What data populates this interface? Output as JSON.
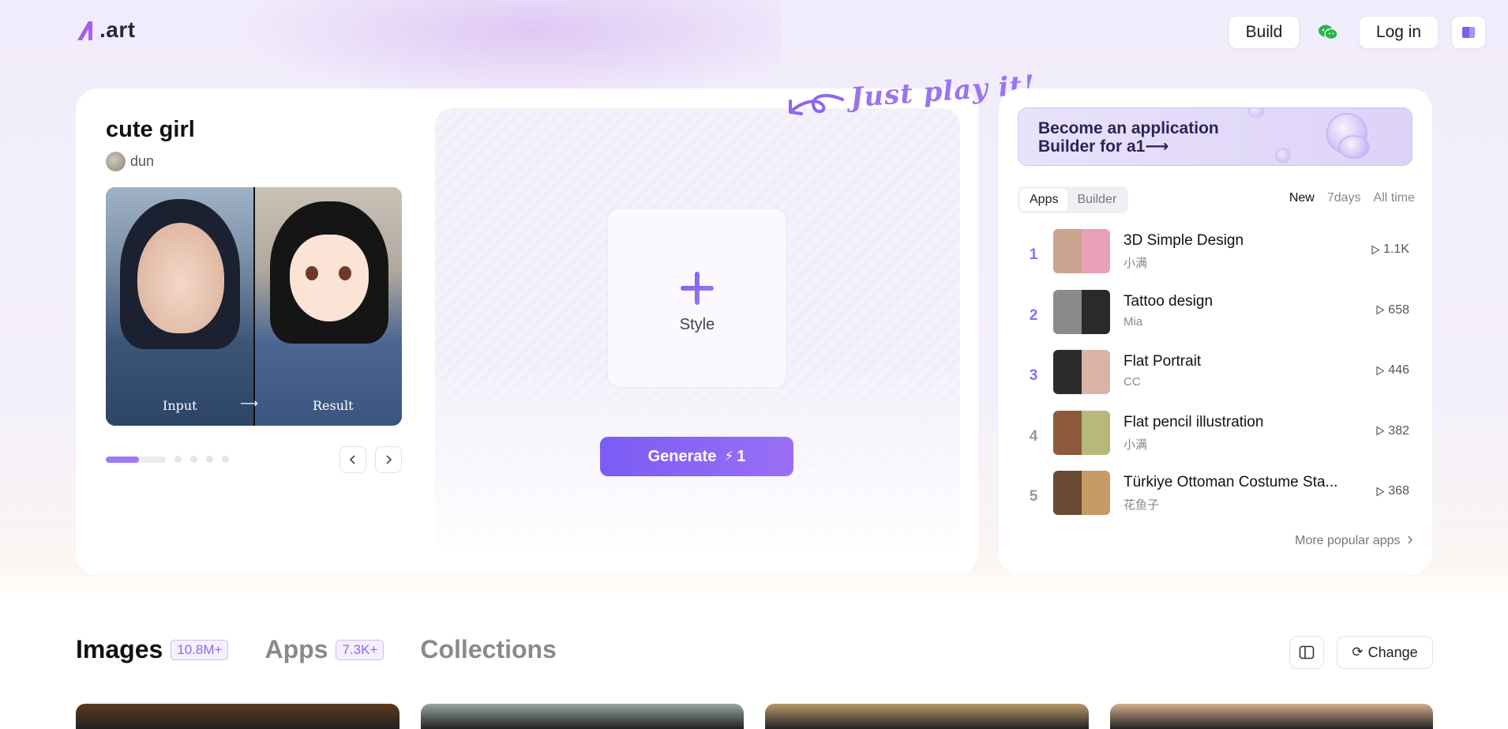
{
  "header": {
    "logo_text": ".art",
    "build_label": "Build",
    "login_label": "Log in"
  },
  "main": {
    "title": "cute girl",
    "author": "dun",
    "preview": {
      "input_label": "Input",
      "arrow": "⟶",
      "result_label": "Result"
    },
    "carousel": {
      "active_progress": 0.55,
      "total_slides": 5
    },
    "style_label": "Style",
    "generate_label": "Generate",
    "generate_cost": "1",
    "tagline": "Just play it!"
  },
  "side": {
    "banner_line1": "Become an application",
    "banner_line2": "Builder for a1⟶",
    "tabs": [
      "Apps",
      "Builder"
    ],
    "filters": [
      "New",
      "7days",
      "All time"
    ],
    "ranking": [
      {
        "rank": "1",
        "title": "3D Simple Design",
        "author": "小满",
        "plays": "1.1K",
        "colors": [
          "#c9a48e",
          "#e7a0b6"
        ]
      },
      {
        "rank": "2",
        "title": "Tattoo design",
        "author": "Mia",
        "plays": "658",
        "colors": [
          "#8a8a8a",
          "#2a2a2a"
        ]
      },
      {
        "rank": "3",
        "title": "Flat Portrait",
        "author": "CC",
        "plays": "446",
        "colors": [
          "#2b2b2b",
          "#d8b3a6"
        ]
      },
      {
        "rank": "4",
        "title": "Flat pencil illustration",
        "author": "小满",
        "plays": "382",
        "colors": [
          "#8c5a3a",
          "#b7b879"
        ]
      },
      {
        "rank": "5",
        "title": "Türkiye Ottoman Costume Sta...",
        "author": "花鱼子",
        "plays": "368",
        "colors": [
          "#6a4a32",
          "#c89a66"
        ]
      }
    ],
    "more_label": "More popular apps"
  },
  "bottom": {
    "tabs": [
      {
        "label": "Images",
        "badge": "10.8M+"
      },
      {
        "label": "Apps",
        "badge": "7.3K+"
      },
      {
        "label": "Collections",
        "badge": ""
      }
    ],
    "change_label": "Change",
    "gallery_colors": [
      "#5b3a1c",
      "#9aa79f",
      "#b89868",
      "#d3ae8c"
    ]
  },
  "colors": {
    "accent": "#8b6cf3",
    "accent_light": "#efe9fd"
  }
}
